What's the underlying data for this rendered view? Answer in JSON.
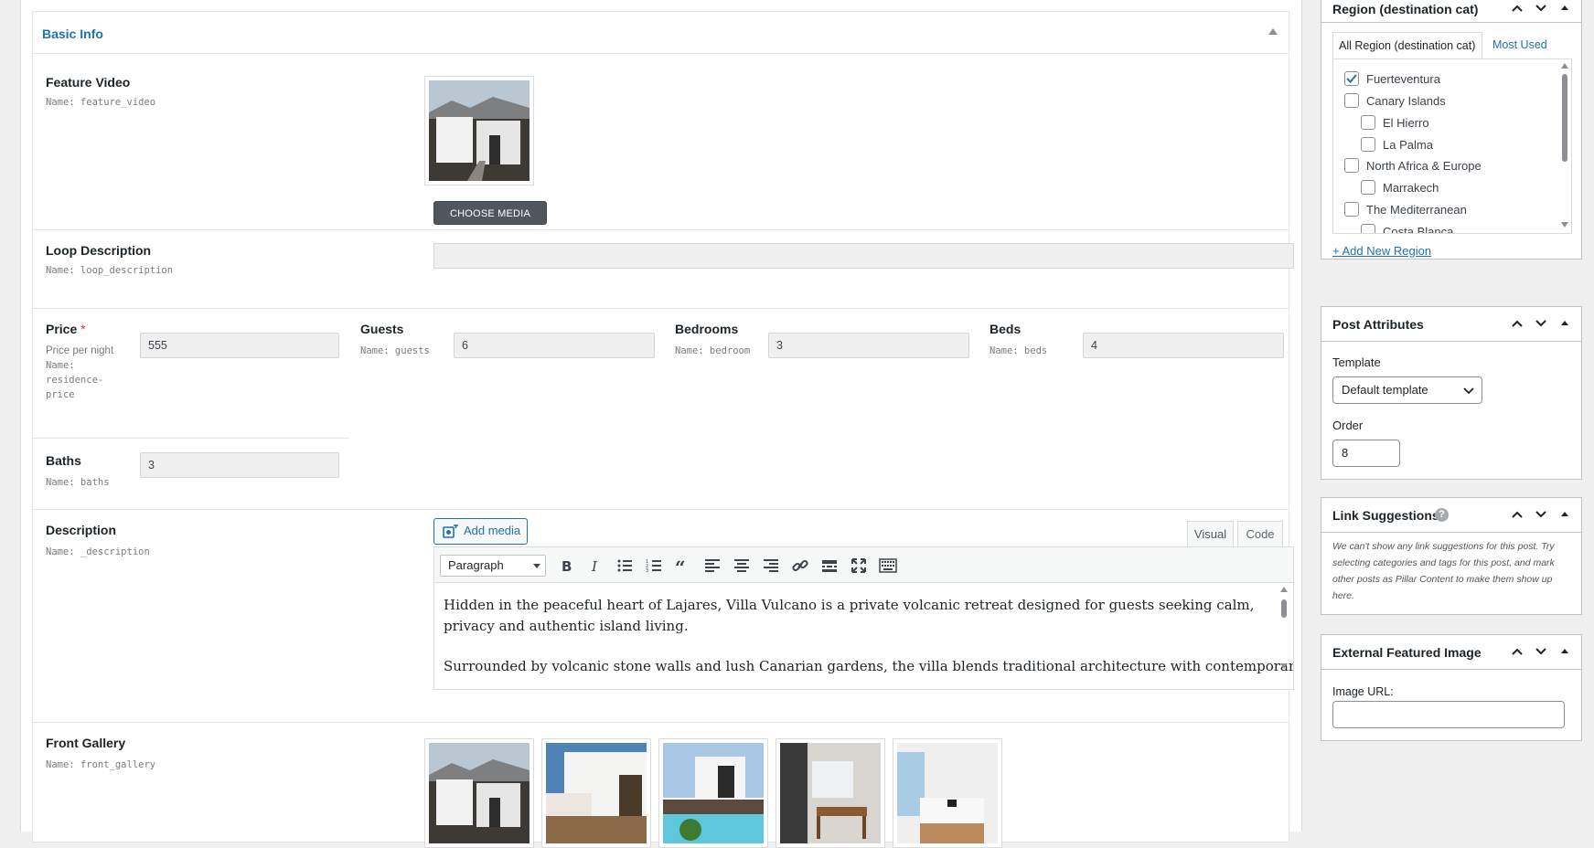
{
  "basic_info": {
    "title": "Basic Info"
  },
  "feature_video": {
    "label": "Feature Video",
    "hint": "Name: feature_video",
    "button": "CHOOSE MEDIA"
  },
  "loop_description": {
    "label": "Loop Description",
    "hint": "Name: loop_description",
    "value": ""
  },
  "price": {
    "label": "Price",
    "required": "*",
    "hint1": "Price per night",
    "hint2": "Name:",
    "hint3": "residence-",
    "hint4": "price",
    "value": "555"
  },
  "guests": {
    "label": "Guests",
    "hint": "Name: guests",
    "value": "6"
  },
  "bedrooms": {
    "label": "Bedrooms",
    "hint": "Name: bedroom",
    "value": "3"
  },
  "beds": {
    "label": "Beds",
    "hint": "Name: beds",
    "value": "4"
  },
  "baths": {
    "label": "Baths",
    "hint": "Name: baths",
    "value": "3"
  },
  "description": {
    "label": "Description",
    "hint": "Name: _description",
    "add_media": "Add media",
    "tab_visual": "Visual",
    "tab_code": "Code",
    "format_select": "Paragraph",
    "paragraph1": "Hidden in the peaceful heart of Lajares, Villa Vulcano is a private volcanic retreat designed for guests seeking calm, privacy and authentic island living.",
    "paragraph2": "Surrounded by volcanic stone walls and lush Canarian gardens, the villa blends traditional architecture with contemporary"
  },
  "front_gallery": {
    "label": "Front Gallery",
    "hint": "Name: front_gallery"
  },
  "region_box": {
    "title": "Region (destination cat)",
    "tab_all": "All Region (destination cat)",
    "tab_most_used": "Most Used",
    "items": [
      {
        "label": "Fuerteventura",
        "checked": true
      },
      {
        "label": "Canary Islands",
        "checked": false
      },
      {
        "label": "El Hierro",
        "checked": false
      },
      {
        "label": "La Palma",
        "checked": false
      },
      {
        "label": "North Africa & Europe",
        "checked": false
      },
      {
        "label": "Marrakech",
        "checked": false
      },
      {
        "label": "The Mediterranean",
        "checked": false
      },
      {
        "label": "Costa Blanca",
        "checked": false
      }
    ],
    "add_new": "+ Add New Region"
  },
  "post_attributes": {
    "title": "Post Attributes",
    "template_label": "Template",
    "template_value": "Default template",
    "order_label": "Order",
    "order_value": "8"
  },
  "link_suggestions": {
    "title": "Link Suggestions",
    "note": "We can't show any link suggestions for this post. Try selecting categories and tags for this post, and mark other posts as Pillar Content to make them show up here."
  },
  "external_featured_image": {
    "title": "External Featured Image",
    "url_label": "Image URL:",
    "url_value": ""
  },
  "colors": {
    "accent": "#2271b1",
    "required": "#d63638",
    "border": "#dcdcde"
  }
}
